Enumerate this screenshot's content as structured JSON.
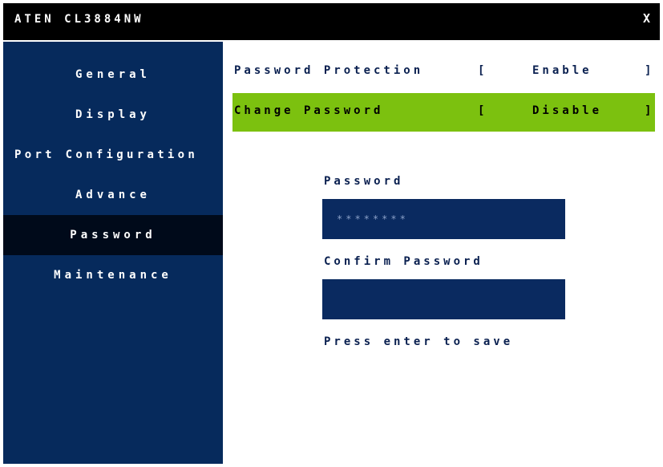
{
  "window": {
    "title": "ATEN CL3884NW",
    "close_label": "X"
  },
  "sidebar": {
    "items": [
      {
        "label": "General"
      },
      {
        "label": "Display"
      },
      {
        "label": "Port Configuration"
      },
      {
        "label": "Advance"
      },
      {
        "label": "Password",
        "active": true
      },
      {
        "label": "Maintenance"
      }
    ]
  },
  "main": {
    "settings": [
      {
        "label": "Password Protection",
        "open": "[",
        "value": "Enable",
        "close": "]"
      },
      {
        "label": "Change Password",
        "open": "[",
        "value": "Disable",
        "close": "]",
        "selected": true
      }
    ],
    "password_label": "Password",
    "password_value": "********",
    "confirm_label": "Confirm Password",
    "confirm_value": "",
    "hint": "Press enter to save"
  },
  "colors": {
    "titlebar": "#000000",
    "sidebar": "#062a5c",
    "active_item": "#000a1a",
    "selected_row": "#7cc10f",
    "input_field": "#0a2a60"
  }
}
